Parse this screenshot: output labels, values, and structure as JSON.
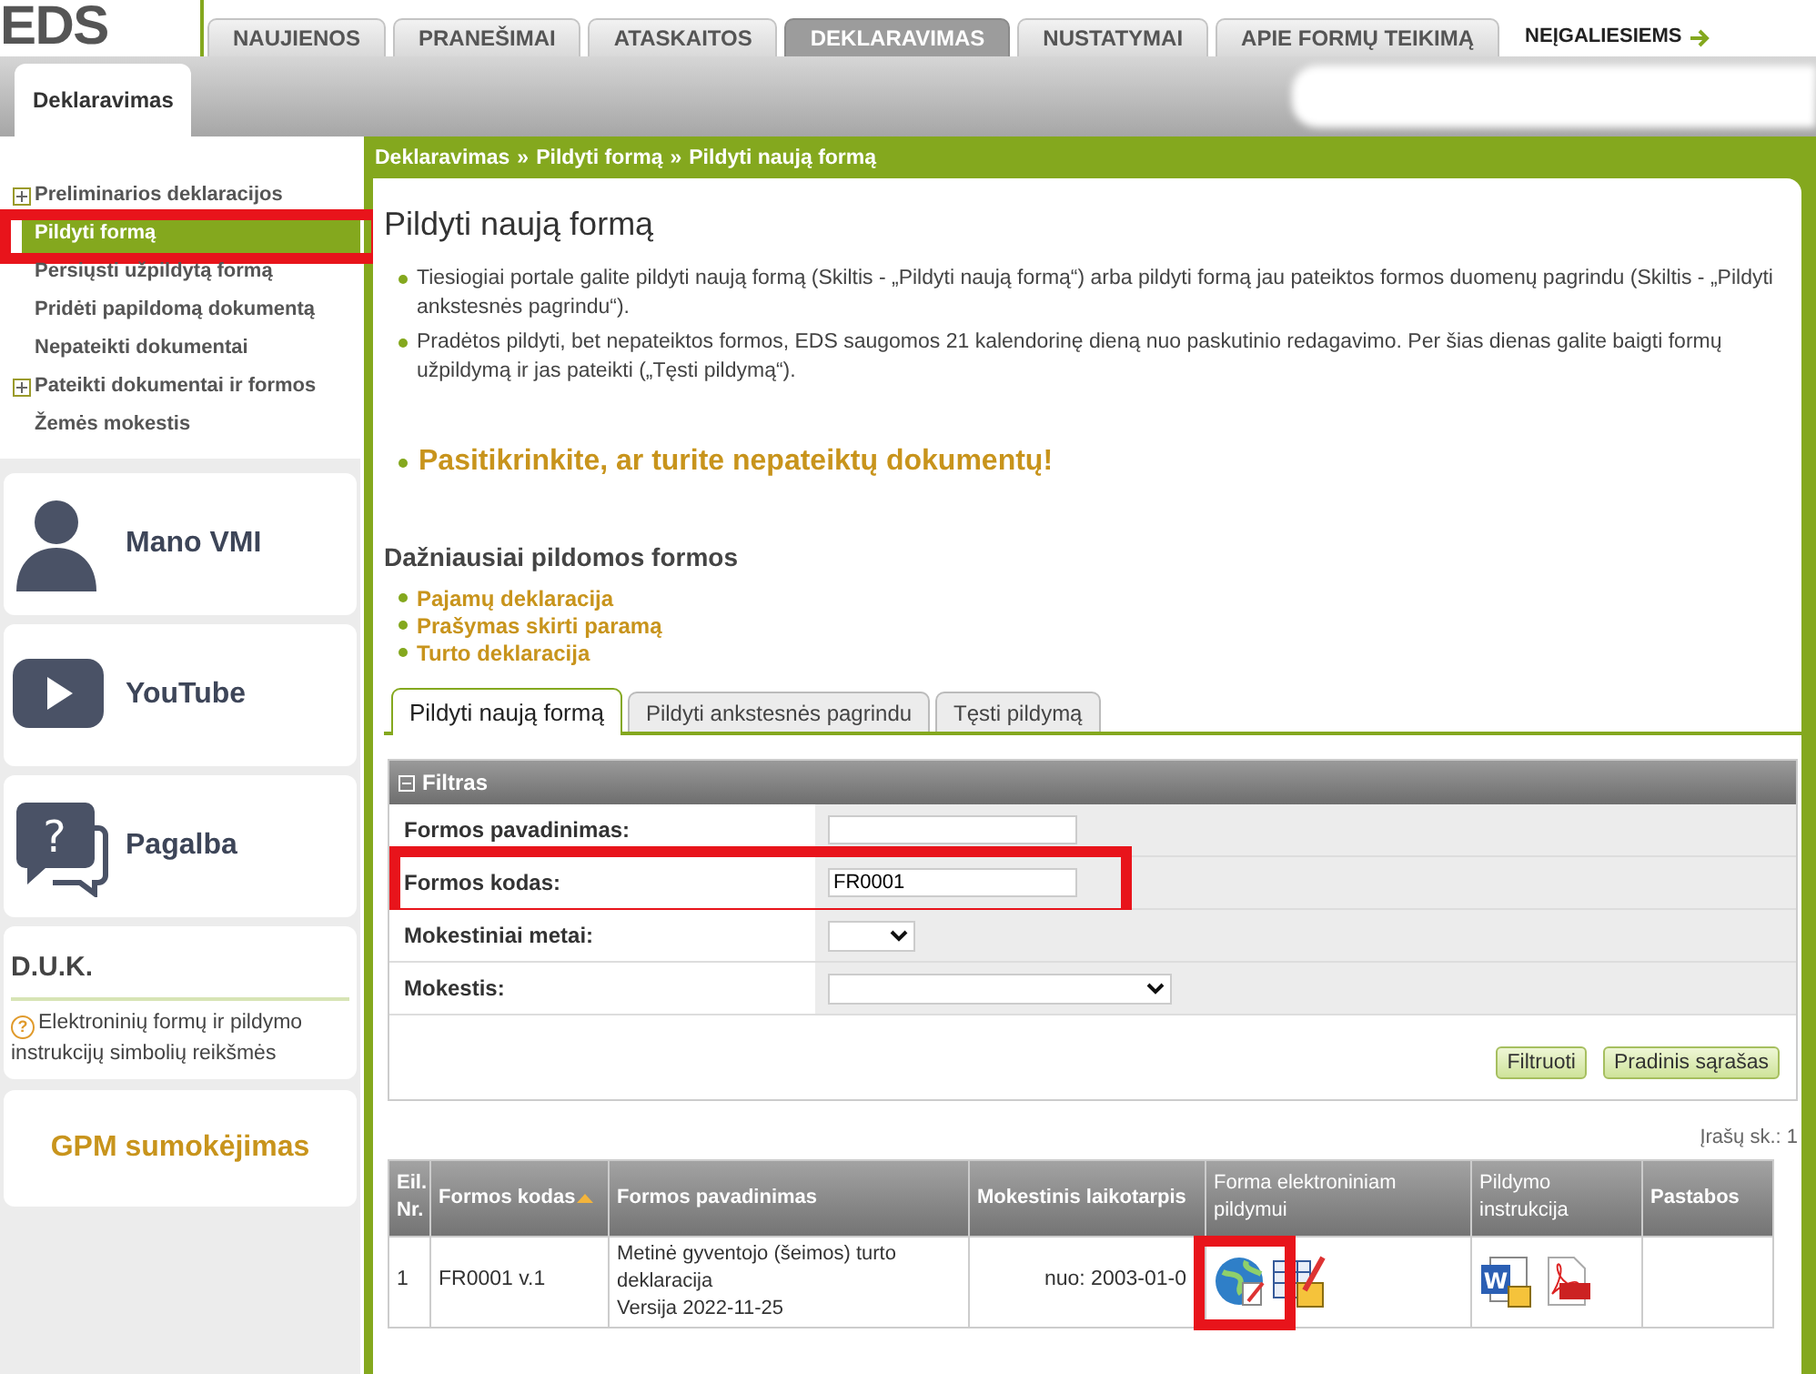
{
  "header": {
    "logo": "EDS",
    "nav_tabs": [
      {
        "label": "NAUJIENOS",
        "selected": false
      },
      {
        "label": "PRANEŠIMAI",
        "selected": false
      },
      {
        "label": "ATASKAITOS",
        "selected": false
      },
      {
        "label": "DEKLARAVIMAS",
        "selected": true
      },
      {
        "label": "NUSTATYMAI",
        "selected": false
      },
      {
        "label": "APIE FORMŲ TEIKIMĄ",
        "selected": false
      }
    ],
    "accessibility_link": "NEĮGALIESIEMS"
  },
  "subnav": {
    "tabs": [
      {
        "label": "Deklaravimas",
        "selected": true
      }
    ]
  },
  "sidebar": {
    "items": [
      {
        "label": "Preliminarios deklaracijos",
        "expandable": true,
        "selected": false,
        "highlighted": false
      },
      {
        "label": "Pildyti formą",
        "expandable": false,
        "selected": true,
        "highlighted": true
      },
      {
        "label": "Persiųsti užpildytą formą",
        "expandable": false,
        "selected": false,
        "highlighted": false
      },
      {
        "label": "Pridėti papildomą dokumentą",
        "expandable": false,
        "selected": false,
        "highlighted": false
      },
      {
        "label": "Nepateikti dokumentai",
        "expandable": false,
        "selected": false,
        "highlighted": false
      },
      {
        "label": "Pateikti dokumentai ir formos",
        "expandable": true,
        "selected": false,
        "highlighted": false
      },
      {
        "label": "Žemės mokestis",
        "expandable": false,
        "selected": false,
        "highlighted": false
      }
    ],
    "cards": [
      {
        "kind": "person",
        "label": "Mano VMI"
      },
      {
        "kind": "video",
        "label": "YouTube"
      },
      {
        "kind": "help",
        "label": "Pagalba",
        "glyph": "?"
      }
    ],
    "faq": {
      "title": "D.U.K.",
      "icon_glyph": "?",
      "link": "Elektroninių formų ir pildymo instrukcijų simbolių reikšmės"
    },
    "payment_link": "GPM sumokėjimas"
  },
  "main": {
    "breadcrumb": [
      "Deklaravimas",
      "Pildyti formą",
      "Pildyti naują formą"
    ],
    "separator": "»",
    "title": "Pildyti naują formą",
    "bullets": [
      "Tiesiogiai portale galite pildyti naują formą (Skiltis - „Pildyti naują formą“) arba pildyti formą jau pateiktos formos duomenų pagrindu (Skiltis - „Pildyti ankstesnės pagrindu“).",
      "Pradėtos pildyti, bet nepateiktos formos, EDS saugomos 21 kalendorinę dieną nuo paskutinio redagavimo. Per šias dienas galite baigti formų užpildymą ir jas pateikti („Tęsti pildymą“)."
    ],
    "alert_link": "Pasitikrinkite, ar turite nepateiktų dokumentų!",
    "popular": {
      "title": "Dažniausiai pildomos formos",
      "links": [
        "Pajamų deklaracija",
        "Prašymas skirti paramą",
        "Turto deklaracija"
      ]
    },
    "tabs": [
      {
        "label": "Pildyti naują formą",
        "selected": true
      },
      {
        "label": "Pildyti ankstesnės pagrindu",
        "selected": false
      },
      {
        "label": "Tęsti pildymą",
        "selected": false
      }
    ],
    "filter": {
      "title": "Filtras",
      "expanded": true,
      "fields": [
        {
          "kind": "text",
          "label": "Formos pavadinimas:",
          "highlighted": false
        },
        {
          "kind": "text",
          "label": "Formos kodas:",
          "value": "FR0001",
          "highlighted": true
        },
        {
          "kind": "short_select",
          "label": "Mokestiniai metai:",
          "highlighted": false
        },
        {
          "kind": "select",
          "label": "Mokestis:",
          "highlighted": false
        }
      ],
      "buttons": [
        "Filtruoti",
        "Pradinis sąrašas"
      ]
    },
    "record_count": "Įrašų sk.: 1",
    "table": {
      "columns": [
        {
          "label": "Eil. Nr.",
          "sorted": false
        },
        {
          "label": "Formos kodas",
          "sorted": true
        },
        {
          "label": "Formos pavadinimas",
          "sorted": false
        },
        {
          "label": "Mokestinis laikotarpis",
          "sorted": false
        },
        {
          "label": "Forma elektroniniam pildymui",
          "sorted": false
        },
        {
          "label": "Pildymo instrukcija",
          "sorted": false
        },
        {
          "label": "Pastabos",
          "sorted": false
        }
      ],
      "rows": [
        {
          "number": "1",
          "code": "FR0001 v.1",
          "name": "Metinė gyventojo (šeimos) turto deklaracija",
          "version": "Versija 2022-11-25",
          "period": "nuo: 2003-01-0",
          "online_form_highlighted": true,
          "instruction_icon_letter": "W"
        }
      ]
    }
  }
}
